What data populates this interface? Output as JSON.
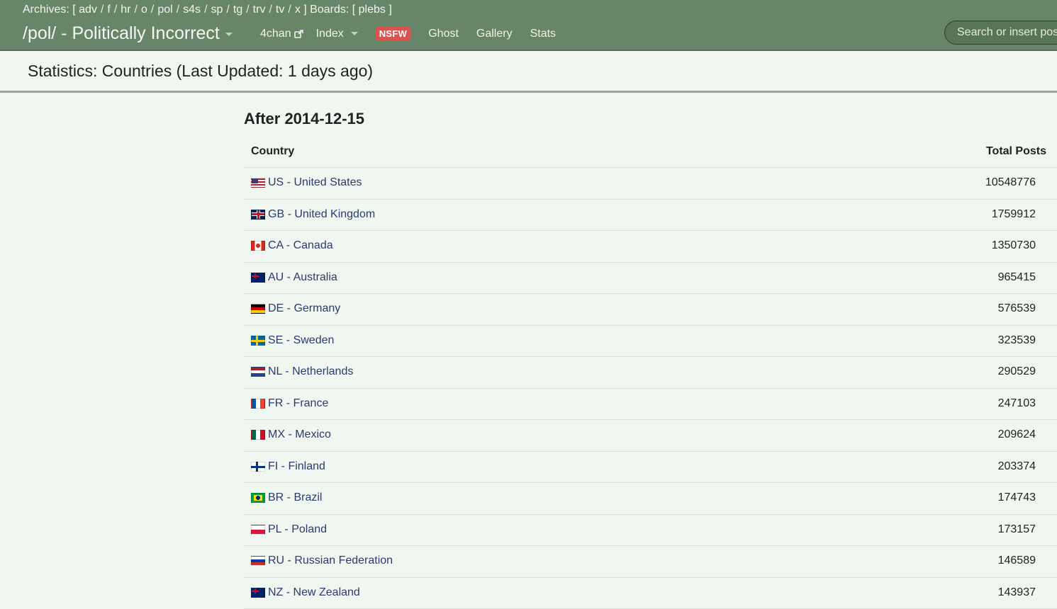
{
  "navbar": {
    "archives_label": "Archives:",
    "archives": [
      "adv",
      "f",
      "hr",
      "o",
      "pol",
      "s4s",
      "sp",
      "tg",
      "trv",
      "tv",
      "x"
    ],
    "boards_label": "Boards:",
    "boards": [
      "plebs"
    ],
    "brand": "/pol/ - Politically Incorrect",
    "links": {
      "fourchan": "4chan",
      "index": "Index",
      "nsfw": "NSFW",
      "ghost": "Ghost",
      "gallery": "Gallery",
      "stats": "Stats"
    },
    "search_placeholder": "Search or insert post no. or thread URL"
  },
  "page": {
    "title": "Statistics: Countries (Last Updated: 1 days ago)",
    "section_title": "After 2014-12-15"
  },
  "table": {
    "headers": {
      "country": "Country",
      "total": "Total Posts"
    },
    "rows": [
      {
        "code": "US",
        "label": "US - United States",
        "total": "10548776",
        "flag": "us"
      },
      {
        "code": "GB",
        "label": "GB - United Kingdom",
        "total": "1759912",
        "flag": "gb"
      },
      {
        "code": "CA",
        "label": "CA - Canada",
        "total": "1350730",
        "flag": "ca"
      },
      {
        "code": "AU",
        "label": "AU - Australia",
        "total": "965415",
        "flag": "au"
      },
      {
        "code": "DE",
        "label": "DE - Germany",
        "total": "576539",
        "flag": "de"
      },
      {
        "code": "SE",
        "label": "SE - Sweden",
        "total": "323539",
        "flag": "se"
      },
      {
        "code": "NL",
        "label": "NL - Netherlands",
        "total": "290529",
        "flag": "nl"
      },
      {
        "code": "FR",
        "label": "FR - France",
        "total": "247103",
        "flag": "fr"
      },
      {
        "code": "MX",
        "label": "MX - Mexico",
        "total": "209624",
        "flag": "mx"
      },
      {
        "code": "FI",
        "label": "FI - Finland",
        "total": "203374",
        "flag": "fi"
      },
      {
        "code": "BR",
        "label": "BR - Brazil",
        "total": "174743",
        "flag": "br"
      },
      {
        "code": "PL",
        "label": "PL - Poland",
        "total": "173157",
        "flag": "pl"
      },
      {
        "code": "RU",
        "label": "RU - Russian Federation",
        "total": "146589",
        "flag": "ru"
      },
      {
        "code": "NZ",
        "label": "NZ - New Zealand",
        "total": "143937",
        "flag": "nz"
      }
    ]
  },
  "colors": {
    "navbar_bg": "#678568",
    "page_bg": "#f0f7f0",
    "link": "#2b3a73",
    "nsfw_badge": "#d9534f"
  },
  "icons": {
    "external_link": "external-link-icon",
    "dropdown": "caret-down-icon"
  }
}
